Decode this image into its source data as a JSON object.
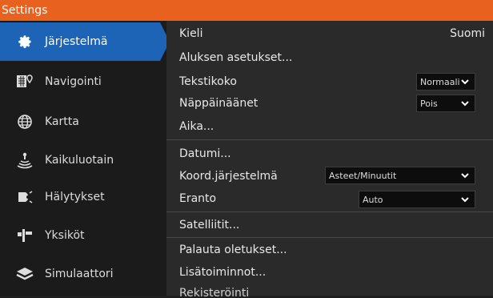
{
  "window": {
    "title": "Settings"
  },
  "sidebar": {
    "items": [
      {
        "label": "Järjestelmä",
        "icon": "gear-icon",
        "active": true
      },
      {
        "label": "Navigointi",
        "icon": "navigation-icon"
      },
      {
        "label": "Kartta",
        "icon": "globe-icon"
      },
      {
        "label": "Kaikuluotain",
        "icon": "sonar-icon"
      },
      {
        "label": "Hälytykset",
        "icon": "alarm-icon"
      },
      {
        "label": "Yksiköt",
        "icon": "units-icon"
      },
      {
        "label": "Simulaattori",
        "icon": "layers-icon"
      }
    ]
  },
  "settings": {
    "language_label": "Kieli",
    "language_value": "Suomi",
    "vessel_label": "Aluksen asetukset...",
    "text_size_label": "Tekstikoko",
    "text_size_value": "Normaali",
    "key_sounds_label": "Näppäinäänet",
    "key_sounds_value": "Pois",
    "time_label": "Aika...",
    "datum_label": "Datumi...",
    "coord_label": "Koord.järjestelmä",
    "coord_value": "Asteet/Minuutit",
    "variation_label": "Eranto",
    "variation_value": "Auto",
    "satellites_label": "Satelliitit...",
    "restore_label": "Palauta oletukset...",
    "advanced_label": "Lisätoiminnot...",
    "registration_label": "Rekisteröinti"
  },
  "colors": {
    "accent": "#1d63b6",
    "titlebar": "#e8611e"
  }
}
